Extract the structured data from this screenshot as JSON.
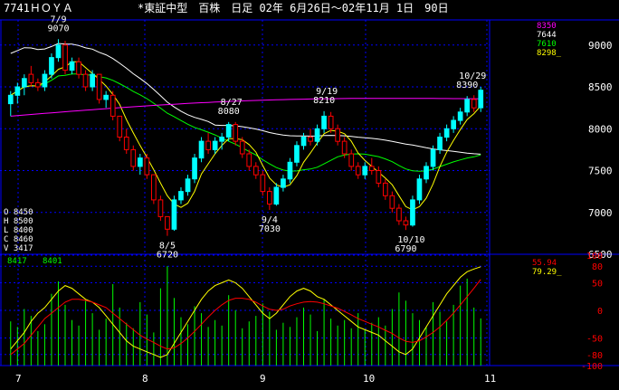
{
  "header": {
    "code_name": "7741ＨＯＹＡ",
    "market_info": "*東証中型　百株　日足 02年 6月26日～02年11月 1日　90日"
  },
  "ohlcv": {
    "o": "O 8450",
    "h": "H 8500",
    "l": "L 8400",
    "c": "C 8460",
    "v": "V 3417"
  },
  "legend": {
    "ma_values": [
      {
        "value": "8350",
        "color": "#ff00ff"
      },
      {
        "value": "7644",
        "color": "#ffffff"
      },
      {
        "value": "7610",
        "color": "#00ff00"
      },
      {
        "value": "8298_",
        "color": "#ffff00"
      }
    ],
    "volume_values": [
      "8417",
      "8401"
    ],
    "osc_values": [
      {
        "value": "55.94",
        "color": "#ff0000"
      },
      {
        "value": "79.29_",
        "color": "#ffff00"
      }
    ]
  },
  "colors": {
    "up_candle": "#00ffff",
    "down_candle": "#ff0000",
    "grid": "#0000ff",
    "volume": "#00ff00",
    "ma_short": "#ffff00",
    "ma_mid": "#00ff00",
    "ma_long": "#ffffff",
    "ma_vlong": "#ff00ff"
  },
  "chart_data": [
    {
      "type": "candlestick",
      "title": "",
      "ylim": [
        6500,
        9300
      ],
      "y_ticks": [
        "9000",
        "8500",
        "8000",
        "7500",
        "7000",
        "6500"
      ],
      "x_ticks": [
        "7",
        "8",
        "9",
        "10",
        "11"
      ],
      "annotations": [
        {
          "date": "7/9",
          "price": "9070"
        },
        {
          "date": "8/5",
          "price": "6720"
        },
        {
          "date": "8/27",
          "price": "8080"
        },
        {
          "date": "9/4",
          "price": "7030"
        },
        {
          "date": "9/19",
          "price": "8210"
        },
        {
          "date": "10/10",
          "price": "6790"
        },
        {
          "date": "10/29",
          "price": "8390"
        }
      ],
      "candles": [
        [
          8300,
          8450,
          8150,
          8400
        ],
        [
          8400,
          8550,
          8300,
          8500
        ],
        [
          8500,
          8650,
          8400,
          8600
        ],
        [
          8650,
          8750,
          8500,
          8550
        ],
        [
          8550,
          8600,
          8450,
          8500
        ],
        [
          8500,
          8700,
          8450,
          8650
        ],
        [
          8650,
          8900,
          8600,
          8850
        ],
        [
          8850,
          9070,
          8800,
          9000
        ],
        [
          9000,
          9050,
          8650,
          8700
        ],
        [
          8700,
          8850,
          8650,
          8800
        ],
        [
          8800,
          8850,
          8600,
          8650
        ],
        [
          8650,
          8700,
          8450,
          8500
        ],
        [
          8500,
          8700,
          8450,
          8650
        ],
        [
          8650,
          8650,
          8300,
          8350
        ],
        [
          8350,
          8450,
          8250,
          8400
        ],
        [
          8400,
          8450,
          8100,
          8150
        ],
        [
          8150,
          8150,
          7850,
          7900
        ],
        [
          7900,
          8000,
          7700,
          7750
        ],
        [
          7750,
          7800,
          7500,
          7550
        ],
        [
          7550,
          7700,
          7450,
          7650
        ],
        [
          7650,
          7700,
          7400,
          7450
        ],
        [
          7450,
          7450,
          7100,
          7150
        ],
        [
          7150,
          7200,
          6900,
          6950
        ],
        [
          6950,
          6950,
          6720,
          6800
        ],
        [
          6800,
          7200,
          6780,
          7150
        ],
        [
          7150,
          7300,
          7100,
          7250
        ],
        [
          7250,
          7450,
          7200,
          7400
        ],
        [
          7400,
          7700,
          7350,
          7650
        ],
        [
          7650,
          7900,
          7600,
          7850
        ],
        [
          7850,
          7950,
          7700,
          7750
        ],
        [
          7750,
          7900,
          7700,
          7850
        ],
        [
          7850,
          7950,
          7750,
          7900
        ],
        [
          7900,
          8080,
          7850,
          8050
        ],
        [
          8050,
          8080,
          7800,
          7850
        ],
        [
          7850,
          7900,
          7650,
          7700
        ],
        [
          7700,
          7750,
          7500,
          7550
        ],
        [
          7550,
          7600,
          7400,
          7450
        ],
        [
          7450,
          7500,
          7200,
          7250
        ],
        [
          7250,
          7300,
          7030,
          7100
        ],
        [
          7100,
          7350,
          7080,
          7300
        ],
        [
          7300,
          7450,
          7250,
          7400
        ],
        [
          7400,
          7650,
          7350,
          7600
        ],
        [
          7600,
          7850,
          7550,
          7800
        ],
        [
          7800,
          7950,
          7750,
          7900
        ],
        [
          7900,
          8000,
          7800,
          7850
        ],
        [
          7850,
          8050,
          7800,
          8000
        ],
        [
          8000,
          8210,
          7950,
          8150
        ],
        [
          8150,
          8200,
          7950,
          8000
        ],
        [
          8000,
          8050,
          7800,
          7850
        ],
        [
          7850,
          7900,
          7650,
          7700
        ],
        [
          7700,
          7750,
          7500,
          7550
        ],
        [
          7550,
          7600,
          7400,
          7450
        ],
        [
          7450,
          7600,
          7400,
          7550
        ],
        [
          7550,
          7650,
          7450,
          7500
        ],
        [
          7500,
          7550,
          7300,
          7350
        ],
        [
          7350,
          7400,
          7150,
          7200
        ],
        [
          7200,
          7250,
          7000,
          7050
        ],
        [
          7050,
          7100,
          6850,
          6900
        ],
        [
          6900,
          6950,
          6790,
          6850
        ],
        [
          6850,
          7200,
          6830,
          7150
        ],
        [
          7150,
          7450,
          7100,
          7400
        ],
        [
          7400,
          7600,
          7350,
          7550
        ],
        [
          7550,
          7800,
          7500,
          7750
        ],
        [
          7750,
          7950,
          7700,
          7900
        ],
        [
          7900,
          8050,
          7850,
          8000
        ],
        [
          8000,
          8150,
          7950,
          8100
        ],
        [
          8100,
          8250,
          8050,
          8200
        ],
        [
          8200,
          8390,
          8150,
          8350
        ],
        [
          8350,
          8400,
          8200,
          8250
        ],
        [
          8250,
          8500,
          8200,
          8460
        ]
      ]
    },
    {
      "type": "bar",
      "title": "",
      "series_name": "",
      "volumes": [
        3200,
        2800,
        4100,
        3600,
        2500,
        3000,
        5200,
        6100,
        4400,
        3300,
        2900,
        4700,
        3800,
        2600,
        3400,
        5900,
        4200,
        3100,
        2700,
        4600,
        3700,
        2400,
        5600,
        7200,
        4900,
        3500,
        3000,
        4300,
        3800,
        2800,
        3300,
        2900,
        5100,
        4000,
        2700,
        3200,
        3600,
        4500,
        3900,
        2600,
        3100,
        2800,
        3500,
        4200,
        3700,
        2500,
        4800,
        3400,
        2900,
        3300,
        2700,
        3800,
        2600,
        3100,
        3500,
        2900,
        4100,
        5300,
        4700,
        3800,
        3300,
        2800,
        4600,
        3900,
        3200,
        4400,
        5800,
        6300,
        4200,
        3417
      ],
      "ylim": [
        0,
        8000
      ]
    },
    {
      "type": "line",
      "title": "",
      "y_ticks": [
        "100",
        "80",
        "50",
        "0",
        "-50",
        "-80",
        "-100"
      ],
      "ylim": [
        -100,
        100
      ],
      "series": [
        {
          "name": "",
          "color": "#ffff00",
          "values": [
            -70,
            -55,
            -40,
            -20,
            -5,
            5,
            20,
            35,
            45,
            40,
            30,
            20,
            15,
            5,
            -10,
            -25,
            -40,
            -55,
            -65,
            -70,
            -75,
            -80,
            -85,
            -80,
            -60,
            -40,
            -20,
            0,
            20,
            35,
            45,
            50,
            55,
            50,
            40,
            25,
            10,
            -5,
            -15,
            -5,
            10,
            25,
            35,
            40,
            35,
            25,
            20,
            10,
            0,
            -10,
            -20,
            -30,
            -35,
            -40,
            -45,
            -55,
            -65,
            -75,
            -80,
            -70,
            -50,
            -30,
            -10,
            10,
            30,
            45,
            60,
            70,
            75,
            79
          ]
        },
        {
          "name": "",
          "color": "#ff0000",
          "values": [
            -80,
            -70,
            -60,
            -45,
            -30,
            -15,
            -5,
            5,
            15,
            20,
            20,
            18,
            15,
            10,
            5,
            -5,
            -15,
            -25,
            -35,
            -45,
            -52,
            -58,
            -65,
            -70,
            -68,
            -60,
            -50,
            -38,
            -25,
            -12,
            0,
            10,
            18,
            22,
            22,
            20,
            15,
            8,
            2,
            0,
            2,
            8,
            12,
            15,
            16,
            15,
            12,
            8,
            4,
            -2,
            -8,
            -15,
            -20,
            -25,
            -30,
            -36,
            -42,
            -50,
            -56,
            -58,
            -55,
            -48,
            -40,
            -30,
            -18,
            -5,
            10,
            25,
            40,
            56
          ]
        }
      ]
    }
  ]
}
